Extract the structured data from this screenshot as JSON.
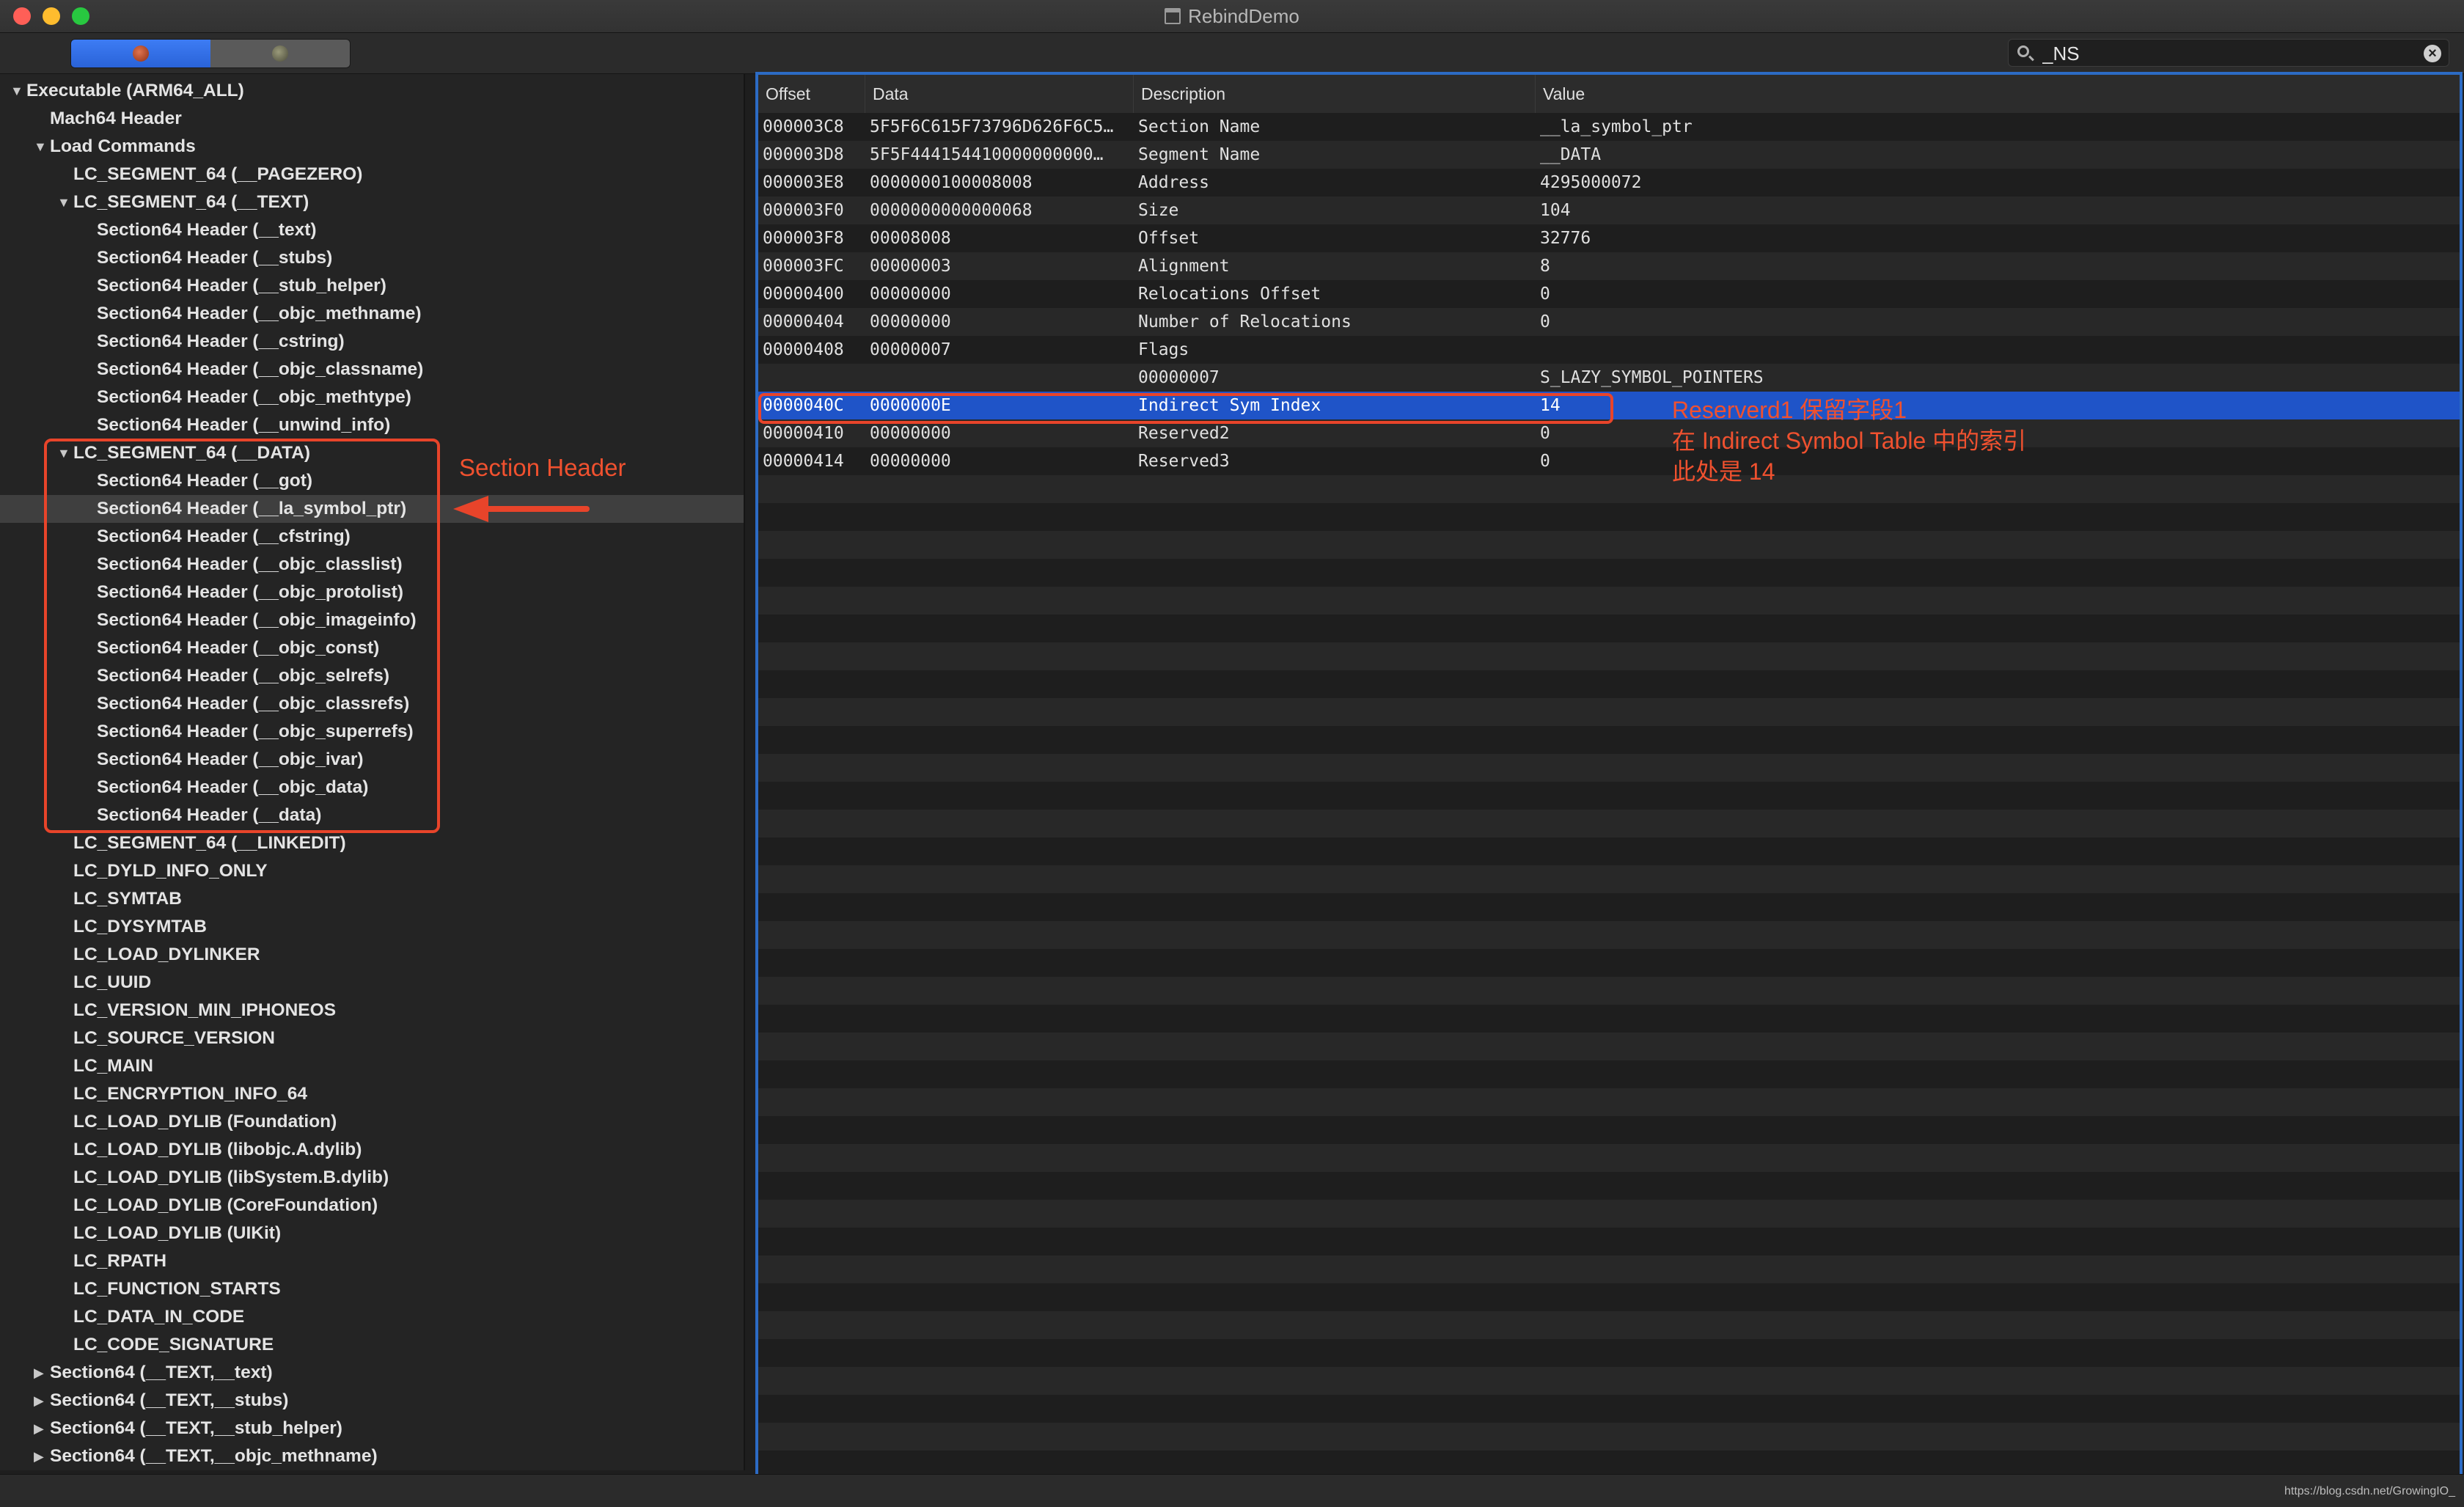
{
  "window": {
    "title": "RebindDemo"
  },
  "toolbar": {
    "segments": [
      {
        "icon": "bug-icon",
        "active": true
      },
      {
        "icon": "bug-icon",
        "active": false
      }
    ],
    "search": {
      "value": "_NS"
    }
  },
  "sidebar": {
    "items": [
      {
        "label": "Executable  (ARM64_ALL)",
        "level": 0,
        "disclosure": "▼"
      },
      {
        "label": "Mach64 Header",
        "level": 1,
        "disclosure": ""
      },
      {
        "label": "Load Commands",
        "level": 1,
        "disclosure": "▼"
      },
      {
        "label": "LC_SEGMENT_64 (__PAGEZERO)",
        "level": 2,
        "disclosure": ""
      },
      {
        "label": "LC_SEGMENT_64 (__TEXT)",
        "level": 2,
        "disclosure": "▼"
      },
      {
        "label": "Section64 Header (__text)",
        "level": 3,
        "disclosure": ""
      },
      {
        "label": "Section64 Header (__stubs)",
        "level": 3,
        "disclosure": ""
      },
      {
        "label": "Section64 Header (__stub_helper)",
        "level": 3,
        "disclosure": ""
      },
      {
        "label": "Section64 Header (__objc_methname)",
        "level": 3,
        "disclosure": ""
      },
      {
        "label": "Section64 Header (__cstring)",
        "level": 3,
        "disclosure": ""
      },
      {
        "label": "Section64 Header (__objc_classname)",
        "level": 3,
        "disclosure": ""
      },
      {
        "label": "Section64 Header (__objc_methtype)",
        "level": 3,
        "disclosure": ""
      },
      {
        "label": "Section64 Header (__unwind_info)",
        "level": 3,
        "disclosure": ""
      },
      {
        "label": "LC_SEGMENT_64 (__DATA)",
        "level": 2,
        "disclosure": "▼"
      },
      {
        "label": "Section64 Header (__got)",
        "level": 3,
        "disclosure": ""
      },
      {
        "label": "Section64 Header (__la_symbol_ptr)",
        "level": 3,
        "disclosure": "",
        "selected": true
      },
      {
        "label": "Section64 Header (__cfstring)",
        "level": 3,
        "disclosure": ""
      },
      {
        "label": "Section64 Header (__objc_classlist)",
        "level": 3,
        "disclosure": ""
      },
      {
        "label": "Section64 Header (__objc_protolist)",
        "level": 3,
        "disclosure": ""
      },
      {
        "label": "Section64 Header (__objc_imageinfo)",
        "level": 3,
        "disclosure": ""
      },
      {
        "label": "Section64 Header (__objc_const)",
        "level": 3,
        "disclosure": ""
      },
      {
        "label": "Section64 Header (__objc_selrefs)",
        "level": 3,
        "disclosure": ""
      },
      {
        "label": "Section64 Header (__objc_classrefs)",
        "level": 3,
        "disclosure": ""
      },
      {
        "label": "Section64 Header (__objc_superrefs)",
        "level": 3,
        "disclosure": ""
      },
      {
        "label": "Section64 Header (__objc_ivar)",
        "level": 3,
        "disclosure": ""
      },
      {
        "label": "Section64 Header (__objc_data)",
        "level": 3,
        "disclosure": ""
      },
      {
        "label": "Section64 Header (__data)",
        "level": 3,
        "disclosure": ""
      },
      {
        "label": "LC_SEGMENT_64 (__LINKEDIT)",
        "level": 2,
        "disclosure": ""
      },
      {
        "label": "LC_DYLD_INFO_ONLY",
        "level": 2,
        "disclosure": ""
      },
      {
        "label": "LC_SYMTAB",
        "level": 2,
        "disclosure": ""
      },
      {
        "label": "LC_DYSYMTAB",
        "level": 2,
        "disclosure": ""
      },
      {
        "label": "LC_LOAD_DYLINKER",
        "level": 2,
        "disclosure": ""
      },
      {
        "label": "LC_UUID",
        "level": 2,
        "disclosure": ""
      },
      {
        "label": "LC_VERSION_MIN_IPHONEOS",
        "level": 2,
        "disclosure": ""
      },
      {
        "label": "LC_SOURCE_VERSION",
        "level": 2,
        "disclosure": ""
      },
      {
        "label": "LC_MAIN",
        "level": 2,
        "disclosure": ""
      },
      {
        "label": "LC_ENCRYPTION_INFO_64",
        "level": 2,
        "disclosure": ""
      },
      {
        "label": "LC_LOAD_DYLIB (Foundation)",
        "level": 2,
        "disclosure": ""
      },
      {
        "label": "LC_LOAD_DYLIB (libobjc.A.dylib)",
        "level": 2,
        "disclosure": ""
      },
      {
        "label": "LC_LOAD_DYLIB (libSystem.B.dylib)",
        "level": 2,
        "disclosure": ""
      },
      {
        "label": "LC_LOAD_DYLIB (CoreFoundation)",
        "level": 2,
        "disclosure": ""
      },
      {
        "label": "LC_LOAD_DYLIB (UIKit)",
        "level": 2,
        "disclosure": ""
      },
      {
        "label": "LC_RPATH",
        "level": 2,
        "disclosure": ""
      },
      {
        "label": "LC_FUNCTION_STARTS",
        "level": 2,
        "disclosure": ""
      },
      {
        "label": "LC_DATA_IN_CODE",
        "level": 2,
        "disclosure": ""
      },
      {
        "label": "LC_CODE_SIGNATURE",
        "level": 2,
        "disclosure": ""
      },
      {
        "label": "Section64 (__TEXT,__text)",
        "level": 1,
        "disclosure": "▶"
      },
      {
        "label": "Section64 (__TEXT,__stubs)",
        "level": 1,
        "disclosure": "▶"
      },
      {
        "label": "Section64 (__TEXT,__stub_helper)",
        "level": 1,
        "disclosure": "▶"
      },
      {
        "label": "Section64 (__TEXT,__objc_methname)",
        "level": 1,
        "disclosure": "▶"
      }
    ]
  },
  "table": {
    "columns": [
      "Offset",
      "Data",
      "Description",
      "Value"
    ],
    "rows": [
      {
        "offset": "000003C8",
        "data": "5F5F6C615F73796D626F6C5…",
        "description": "Section Name",
        "value": "__la_symbol_ptr"
      },
      {
        "offset": "000003D8",
        "data": "5F5F444154410000000000…",
        "description": "Segment Name",
        "value": "__DATA"
      },
      {
        "offset": "000003E8",
        "data": "0000000100008008",
        "description": "Address",
        "value": "4295000072"
      },
      {
        "offset": "000003F0",
        "data": "0000000000000068",
        "description": "Size",
        "value": "104"
      },
      {
        "offset": "000003F8",
        "data": "00008008",
        "description": "Offset",
        "value": "32776"
      },
      {
        "offset": "000003FC",
        "data": "00000003",
        "description": "Alignment",
        "value": "8"
      },
      {
        "offset": "00000400",
        "data": "00000000",
        "description": "Relocations Offset",
        "value": "0"
      },
      {
        "offset": "00000404",
        "data": "00000000",
        "description": "Number of Relocations",
        "value": "0"
      },
      {
        "offset": "00000408",
        "data": "00000007",
        "description": "Flags",
        "value": ""
      },
      {
        "offset": "",
        "data": "",
        "description": "00000007",
        "value": "S_LAZY_SYMBOL_POINTERS"
      },
      {
        "offset": "0000040C",
        "data": "0000000E",
        "description": "Indirect Sym Index",
        "value": "14",
        "selected": true
      },
      {
        "offset": "00000410",
        "data": "00000000",
        "description": "Reserved2",
        "value": "0"
      },
      {
        "offset": "00000414",
        "data": "00000000",
        "description": "Reserved3",
        "value": "0"
      }
    ]
  },
  "annotations": {
    "section_header_label": "Section Header",
    "reserved_line1": "Reserverd1 保留字段1",
    "reserved_line2": "在 Indirect Symbol Table 中的索引",
    "reserved_line3": "此处是 14",
    "color": "#e8442a"
  },
  "statusbar": {
    "watermark": "https://blog.csdn.net/GrowingIO_"
  }
}
